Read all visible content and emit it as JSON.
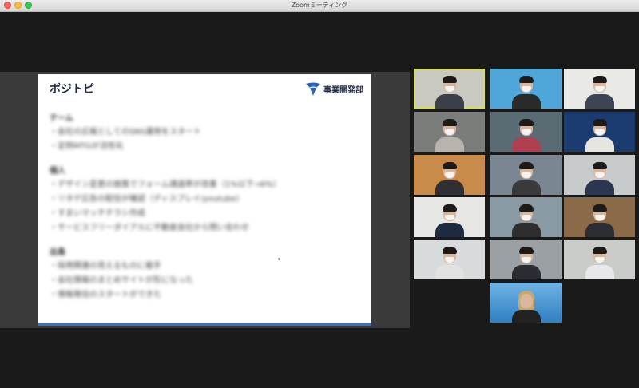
{
  "window": {
    "title": "Zoomミーティング"
  },
  "slide": {
    "title": "ポジトピ",
    "logo_text": "事業開発部",
    "sections": [
      {
        "heading": "テーム",
        "bullets": [
          "・会社の広報としてのSNS運用をスタート",
          "・定例MTGが活性化"
        ]
      },
      {
        "heading": "個人",
        "bullets": [
          "・デザイン変更の施策でフォーム通過率が改善（1%以下→6%）",
          "・リタゲ広告の配信が確認（ディスプレイ/youtube）",
          "・すまいマッチチラシ作成",
          "・サービスフリーダイアルに不動産会社から問い合わせ"
        ]
      },
      {
        "heading": "出島",
        "bullets": [
          "・採用関連の見えるものに着手",
          "・会社情報のまとめサイトが形になった",
          "・情報発信のスタートができた"
        ]
      }
    ]
  },
  "participants_count": 16,
  "colors": {
    "active_speaker_border": "#d6e04a",
    "background": "#1a1a1a",
    "slide_accent": "#4a6ea9"
  }
}
